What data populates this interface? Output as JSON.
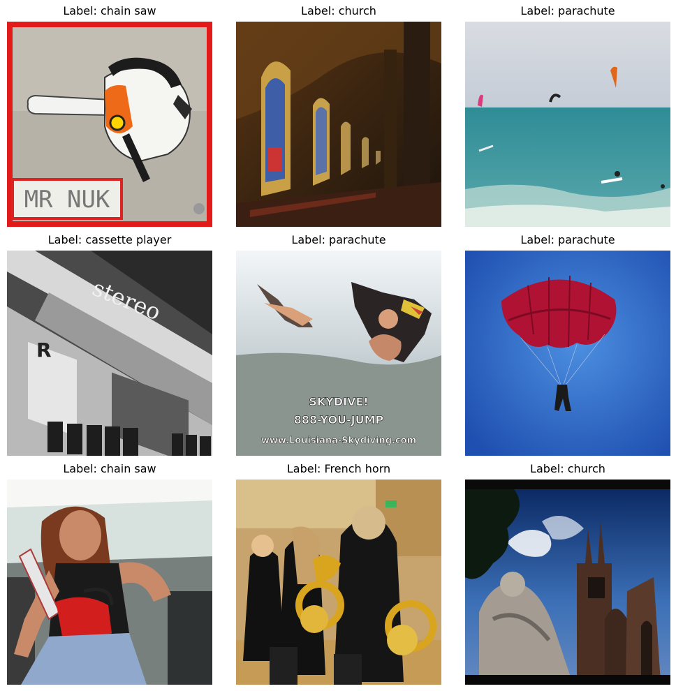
{
  "panels": [
    {
      "title": "Label: chain saw",
      "overlay_text": [
        "MR NUK"
      ]
    },
    {
      "title": "Label: church"
    },
    {
      "title": "Label: parachute"
    },
    {
      "title": "Label: cassette player",
      "overlay_text": [
        "stereo"
      ]
    },
    {
      "title": "Label: parachute",
      "overlay_text": [
        "SKYDIVE!",
        "888-YOU-JUMP",
        "www.Louisiana-Skydiving.com"
      ]
    },
    {
      "title": "Label: parachute"
    },
    {
      "title": "Label: chain saw"
    },
    {
      "title": "Label: French horn"
    },
    {
      "title": "Label: church"
    }
  ]
}
